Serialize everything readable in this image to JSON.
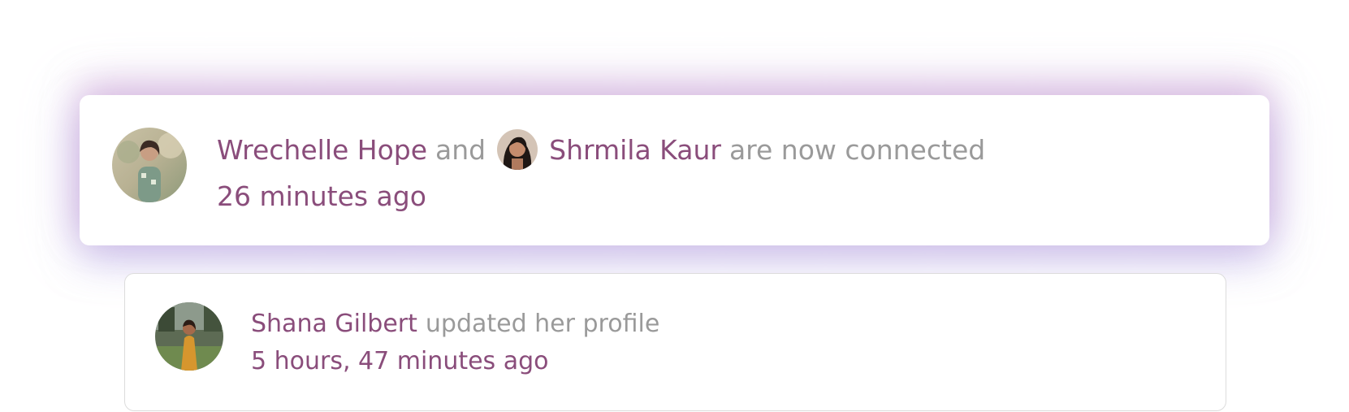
{
  "activity": [
    {
      "actor": "Wrechelle Hope",
      "conjunction": "and",
      "target": "Shrmila Kaur",
      "action": "are now connected",
      "time": "26 minutes ago",
      "actor_avatar": "avatar-photo",
      "target_avatar": "avatar-photo"
    },
    {
      "actor": "Shana Gilbert",
      "action": "updated her profile",
      "time": "5 hours, 47 minutes ago",
      "actor_avatar": "avatar-photo"
    }
  ],
  "colors": {
    "link": "#8a4d7b",
    "muted_text": "#9a9a9a",
    "glow_top": "#cda0d2",
    "glow_bottom": "#b4aae6"
  }
}
